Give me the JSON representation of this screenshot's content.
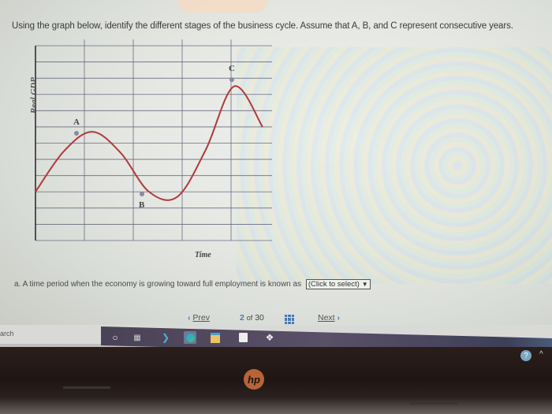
{
  "question": {
    "text": "Using the graph below, identify the different stages of the business cycle. Assume that A, B, and C represent consecutive years."
  },
  "chart_data": {
    "type": "line",
    "title": "",
    "xlabel": "Time",
    "ylabel": "Real GDP",
    "grid": true,
    "x": [
      0,
      1,
      2,
      3,
      4,
      5,
      6,
      7,
      8
    ],
    "series": [
      {
        "name": "Real GDP",
        "color": "#b03a3a",
        "values": [
          3.0,
          5.5,
          6.7,
          5.4,
          3.0,
          2.7,
          5.6,
          9.5,
          7.0
        ]
      }
    ],
    "points": [
      {
        "label": "A",
        "x": 2,
        "y": 6.7
      },
      {
        "label": "B",
        "x": 4.3,
        "y": 2.7
      },
      {
        "label": "C",
        "x": 8,
        "y": 9.7
      }
    ],
    "xlim": [
      0,
      10
    ],
    "ylim": [
      0,
      12
    ]
  },
  "question_a": {
    "text": "a. A time period when the economy is growing toward full employment is known as",
    "dropdown_value": "(Click to select)"
  },
  "pagination": {
    "prev_label": "Prev",
    "current": "2",
    "of_label": "of",
    "total": "30",
    "next_label": "Next"
  },
  "taskbar": {
    "search_text": "arch",
    "icons": [
      "cortana-icon",
      "task-view-icon",
      "app-icon",
      "edge-icon",
      "file-explorer-icon",
      "store-icon",
      "dropbox-icon"
    ]
  },
  "laptop": {
    "brand": "hp"
  },
  "tray": {
    "help_glyph": "?",
    "caret_glyph": "^"
  }
}
